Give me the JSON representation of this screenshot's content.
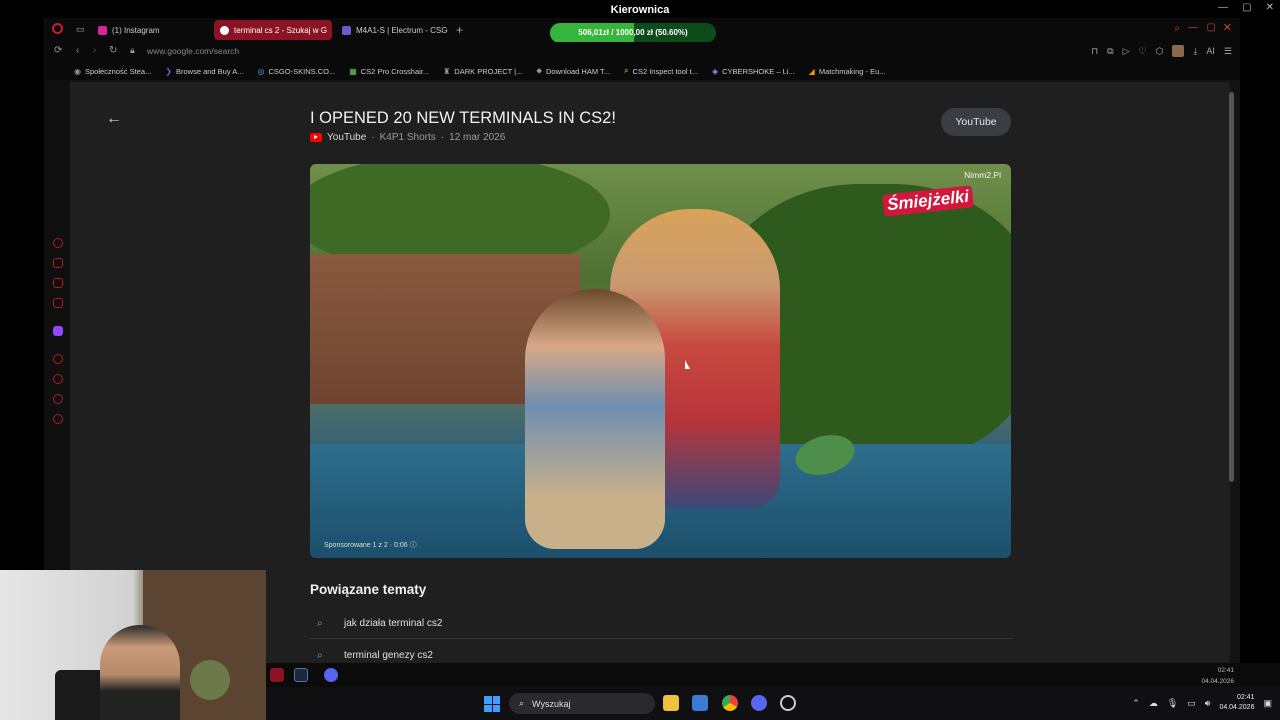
{
  "os": {
    "window_title": "Kierownica",
    "controls": [
      "—",
      "▢",
      "✕"
    ]
  },
  "tabs": [
    {
      "label": "(1) Instagram",
      "active": false,
      "icon": "instagram-icon",
      "color": "#d6249f"
    },
    {
      "label": "terminal cs 2 - Szukaj w G",
      "active": true,
      "icon": "opera-icon",
      "color": "#ff3355"
    },
    {
      "label": "M4A1-S | Electrum - CSGO",
      "active": false,
      "icon": "electrum-icon",
      "color": "#6a5acd"
    }
  ],
  "promo": {
    "text": "506,01zł / 1000,00 zł (50.60%)",
    "progress": 0.506,
    "colors": {
      "fill": "#35b53b",
      "track": "#0e4b1b"
    }
  },
  "address": {
    "url": "www.google.com/search"
  },
  "toolbar": {
    "ai_label": "AI"
  },
  "bookmarks": [
    {
      "label": "Społeczność Stea...",
      "icon": "steam-icon"
    },
    {
      "label": "Browse and Buy A...",
      "icon": "bookmark-icon"
    },
    {
      "label": "CSGO-SKINS.CO...",
      "icon": "globe-icon"
    },
    {
      "label": "CS2 Pro Crosshair...",
      "icon": "crosshair-icon"
    },
    {
      "label": "DARK PROJECT |...",
      "icon": "dark-project-icon"
    },
    {
      "label": "Download HAM T...",
      "icon": "download-icon"
    },
    {
      "label": "CS2 Inspect tool t...",
      "icon": "search-icon"
    },
    {
      "label": "CYBERSHOKE – Li...",
      "icon": "cybershoke-icon"
    },
    {
      "label": "Matchmaking - Eu...",
      "icon": "faceit-icon"
    }
  ],
  "result": {
    "title": "I OPENED 20 NEW TERMINALS IN CS2!",
    "source": "YouTube",
    "channel": "K4P1 Shorts",
    "date": "12 mar 2026",
    "open_button": "YouTube"
  },
  "video": {
    "brand_tag": "Nimm2.Pl",
    "brand_logo": "Śmiejżelki",
    "sponsor_text": "Sponsorowane 1 z 2 · 0:06 ⓘ"
  },
  "related": {
    "heading": "Powiązane tematy",
    "items": [
      "jak działa terminal cs2",
      "terminal genezy cs2"
    ]
  },
  "taskbar": {
    "search_placeholder": "Wyszukaj",
    "time": "02:41",
    "date": "04.04.2026",
    "mini_time": "02:41",
    "mini_date": "04.04.2026"
  },
  "colors": {
    "accent": "#8b1323",
    "page_bg": "#1f1f1f",
    "youtube_red": "#ff0000"
  }
}
